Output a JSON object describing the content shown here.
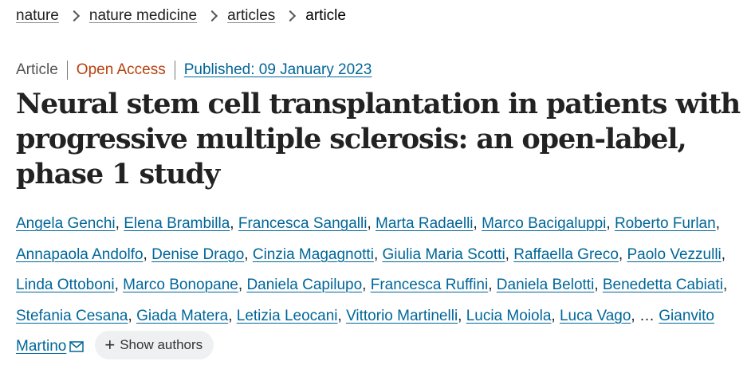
{
  "breadcrumb": {
    "items": [
      "nature",
      "nature medicine",
      "articles"
    ],
    "current": "article"
  },
  "meta": {
    "type": "Article",
    "access": "Open Access",
    "published": "Published: 09 January 2023"
  },
  "title": "Neural stem cell transplantation in patients with progressive multiple sclerosis: an open-label, phase 1 study",
  "authors": {
    "list": [
      "Angela Genchi",
      "Elena Brambilla",
      "Francesca Sangalli",
      "Marta Radaelli",
      "Marco Bacigaluppi",
      "Roberto Furlan",
      "Annapaola Andolfo",
      "Denise Drago",
      "Cinzia Magagnotti",
      "Giulia Maria Scotti",
      "Raffaella Greco",
      "Paolo Vezzulli",
      "Linda Ottoboni",
      "Marco Bonopane",
      "Daniela Capilupo",
      "Francesca Ruffini",
      "Daniela Belotti",
      "Benedetta Cabiati",
      "Stefania Cesana",
      "Giada Matera",
      "Letizia Leocani",
      "Vittorio Martinelli",
      "Lucia Moiola",
      "Luca Vago"
    ],
    "ellipsis": "…",
    "corresponding": "Gianvito Martino",
    "show_authors_label": "Show authors"
  },
  "colors": {
    "link": "#006699",
    "open_access": "#b7410e",
    "text": "#222222",
    "button_bg": "#eef0f2"
  },
  "icons": {
    "separator": "chevron-right-icon",
    "email": "mail-icon",
    "expand": "plus-icon"
  }
}
